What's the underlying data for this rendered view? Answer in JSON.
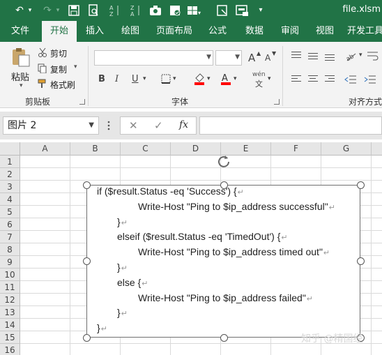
{
  "title_bar": {
    "filename": "file.xlsm",
    "quick_access": {
      "undo": "↶",
      "undo_menu": "▾",
      "redo": "↷",
      "redo_menu": "▾",
      "more": "▾"
    }
  },
  "tabs": [
    {
      "label": "文件",
      "active": false
    },
    {
      "label": "开始",
      "active": true
    },
    {
      "label": "插入",
      "active": false
    },
    {
      "label": "绘图",
      "active": false
    },
    {
      "label": "页面布局",
      "active": false
    },
    {
      "label": "公式",
      "active": false
    },
    {
      "label": "数据",
      "active": false
    },
    {
      "label": "审阅",
      "active": false
    },
    {
      "label": "视图",
      "active": false
    },
    {
      "label": "开发工具",
      "active": false
    }
  ],
  "ribbon": {
    "clipboard": {
      "group_label": "剪贴板",
      "paste_label": "粘贴",
      "cut_label": "剪切",
      "copy_label": "复制",
      "format_painter_label": "格式刷"
    },
    "font": {
      "group_label": "字体",
      "font_name": "",
      "font_size": "",
      "bold": "B",
      "italic": "I",
      "underline": "U",
      "grow": "A",
      "shrink": "A",
      "wen": "wén",
      "wen_char": "文"
    },
    "alignment": {
      "group_label": "对齐方式"
    }
  },
  "formula_bar": {
    "name_box": "图片 2",
    "cancel": "✕",
    "enter": "✓",
    "fx": "fx",
    "formula": ""
  },
  "columns": [
    "A",
    "B",
    "C",
    "D",
    "E",
    "F",
    "G"
  ],
  "rows": [
    "1",
    "2",
    "3",
    "4",
    "5",
    "6",
    "7",
    "8",
    "9",
    "10",
    "11",
    "12",
    "13",
    "14",
    "15",
    "16"
  ],
  "code_lines": [
    "if ($result.Status -eq 'Success') {",
    "Write-Host \"Ping to $ip_address successful\"",
    "}",
    "elseif ($result.Status -eq 'TimedOut') {",
    "Write-Host \"Ping to $ip_address timed out\"",
    "}",
    "else {",
    "Write-Host \"Ping to $ip_address failed\"",
    "}",
    "}"
  ],
  "paragraph_mark": "↵",
  "watermark": "知乎 @精国经",
  "colors": {
    "accent": "#217346",
    "ribbon_bg": "#f3f3f3",
    "header_bg": "#e6e6e6"
  }
}
